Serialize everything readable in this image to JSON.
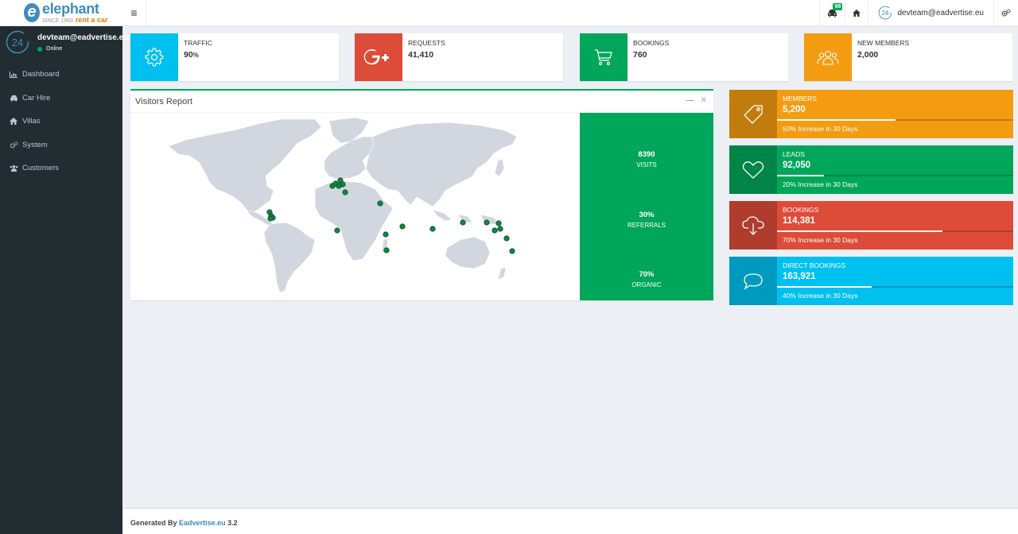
{
  "brand": {
    "name": "elephant",
    "tagline": "SINCE 1983",
    "sub": "rent a car",
    "color": "#3c8dbc"
  },
  "header": {
    "menu_icon": "hamburger-icon",
    "notif_badge": "98",
    "user_email": "devteam@eadvertise.eu"
  },
  "sidebar": {
    "user": {
      "email": "devteam@eadvertise.eu",
      "status": "Online"
    },
    "items": [
      {
        "label": "Dashboard",
        "icon": "bar-chart-icon"
      },
      {
        "label": "Car Hire",
        "icon": "car-icon"
      },
      {
        "label": "Villas",
        "icon": "home-icon"
      },
      {
        "label": "System",
        "icon": "cogs-icon"
      },
      {
        "label": "Customers",
        "icon": "users-icon"
      }
    ]
  },
  "info_boxes": [
    {
      "label": "TRAFFIC",
      "value": "90",
      "unit": "%",
      "color": "#00c0ef",
      "icon": "gear-icon"
    },
    {
      "label": "REQUESTS",
      "value": "41,410",
      "unit": "",
      "color": "#dd4b39",
      "icon": "google-plus-icon"
    },
    {
      "label": "BOOKINGS",
      "value": "760",
      "unit": "",
      "color": "#00a65a",
      "icon": "cart-icon"
    },
    {
      "label": "NEW MEMBERS",
      "value": "2,000",
      "unit": "",
      "color": "#f39c12",
      "icon": "users-icon"
    }
  ],
  "visitors": {
    "title": "Visitors Report",
    "stats": [
      {
        "value": "8390",
        "label": "VISITS"
      },
      {
        "value": "30%",
        "label": "REFERRALS"
      },
      {
        "value": "70%",
        "label": "ORGANIC"
      }
    ]
  },
  "colored_boxes": [
    {
      "label": "MEMBERS",
      "value": "5,200",
      "progress": 0.5,
      "desc": "50% Increase in 30 Days",
      "color": "#f39c12",
      "icon": "tag-icon"
    },
    {
      "label": "LEADS",
      "value": "92,050",
      "progress": 0.2,
      "desc": "20% Increase in 30 Days",
      "color": "#00a65a",
      "icon": "heart-icon"
    },
    {
      "label": "BOOKINGS",
      "value": "114,381",
      "progress": 0.7,
      "desc": "70% Increase in 30 Days",
      "color": "#dd4b39",
      "icon": "cloud-download-icon"
    },
    {
      "label": "DIRECT BOOKINGS",
      "value": "163,921",
      "progress": 0.4,
      "desc": "40% Increase in 30 Days",
      "color": "#00c0ef",
      "icon": "comment-icon"
    }
  ],
  "footer": {
    "prefix": "Generated By",
    "link": "Eadvertise.eu",
    "version": "3.2"
  }
}
